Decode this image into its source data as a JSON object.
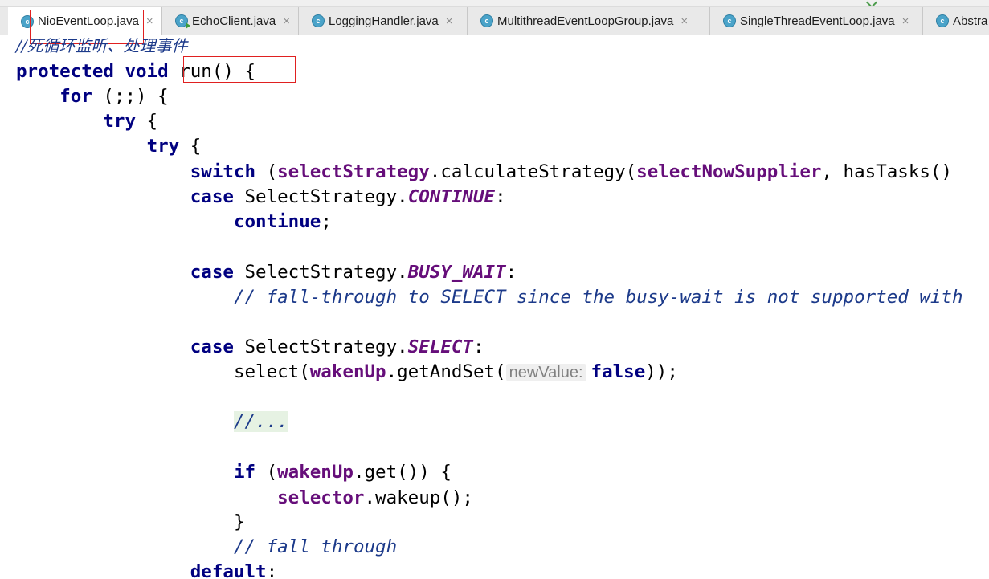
{
  "tabs": [
    {
      "label": "NioEventLoop.java",
      "active": true,
      "icon": "java-class-icon"
    },
    {
      "label": "EchoClient.java",
      "active": false,
      "icon": "java-runnable-class-icon"
    },
    {
      "label": "LoggingHandler.java",
      "active": false,
      "icon": "java-class-icon"
    },
    {
      "label": "MultithreadEventLoopGroup.java",
      "active": false,
      "icon": "java-class-icon"
    },
    {
      "label": "SingleThreadEventLoop.java",
      "active": false,
      "icon": "java-class-icon"
    },
    {
      "label": "Abstra",
      "active": false,
      "icon": "java-class-icon"
    }
  ],
  "tab_close_glyph": "×",
  "tab_icon_letter": "c",
  "editor": {
    "comment_cn": "//死循环监听、处理事件",
    "kw_protected": "protected",
    "kw_void": "void",
    "method_sig": "run() {",
    "kw_for": "for",
    "for_rest": " (;;) {",
    "kw_try": "try",
    "brace_open": " {",
    "kw_switch": "switch",
    "paren_open": " (",
    "field_selectStrategy": "selectStrategy",
    "calc_call": ".calculateStrategy(",
    "field_selectNowSupplier": "selectNowSupplier",
    "has_tasks": ", hasTasks()",
    "kw_case": "case",
    "select_strategy_class": " SelectStrategy.",
    "const_continue": "CONTINUE",
    "colon": ":",
    "kw_continue": "continue",
    "semicolon": ";",
    "const_busy_wait": "BUSY_WAIT",
    "comment_fallthrough_select": "// fall-through to SELECT since the busy-wait is not supported with",
    "const_select": "SELECT",
    "select_call": "select(",
    "field_wakenUp": "wakenUp",
    "get_and_set": ".getAndSet(",
    "param_hint": "newValue:",
    "kw_false": "false",
    "close_call": "));",
    "folded_code": "//...",
    "kw_if": "if",
    "get_call": ".get()) {",
    "field_selector": "selector",
    "wakeup_call": ".wakeup();",
    "brace_close": "}",
    "comment_fall_through": "// fall through",
    "kw_default": "default"
  },
  "colors": {
    "keyword": "#000080",
    "field": "#660e7a",
    "comment": "#1c3a8a",
    "highlight_box": "#e02020"
  }
}
